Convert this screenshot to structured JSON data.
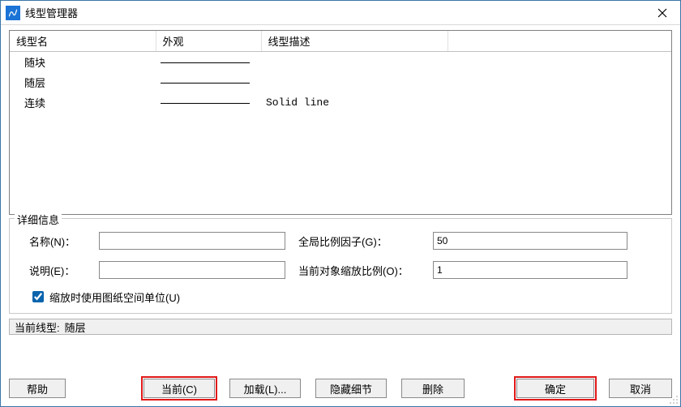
{
  "window": {
    "title": "线型管理器"
  },
  "table": {
    "headers": {
      "name": "线型名",
      "appearance": "外观",
      "desc": "线型描述"
    },
    "rows": [
      {
        "name": "随块",
        "desc": ""
      },
      {
        "name": "随层",
        "desc": ""
      },
      {
        "name": "连续",
        "desc": "Solid line"
      }
    ]
  },
  "details": {
    "legend": "详细信息",
    "name_label": "名称(N)：",
    "name_value": "",
    "desc_label": "说明(E)：",
    "desc_value": "",
    "global_scale_label": "全局比例因子(G)：",
    "global_scale_value": "50",
    "obj_scale_label": "当前对象缩放比例(O)：",
    "obj_scale_value": "1",
    "use_paper_units_label": "缩放时使用图纸空间单位(U)",
    "use_paper_units_checked": true
  },
  "current_bar": {
    "label": "当前线型:",
    "value": "随层"
  },
  "buttons": {
    "help": "帮助",
    "current": "当前(C)",
    "load": "加载(L)...",
    "hide_details": "隐藏细节",
    "delete": "删除",
    "ok": "确定",
    "cancel": "取消"
  }
}
